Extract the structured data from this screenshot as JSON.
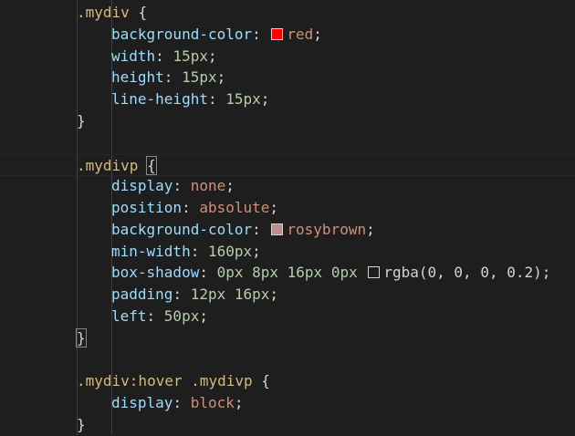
{
  "rules": [
    {
      "selector": ".mydiv",
      "open": "{",
      "close": "}",
      "declarations": [
        {
          "prop": "background-color",
          "value": "red",
          "swatch": "#ff0000"
        },
        {
          "prop": "width",
          "value": "15px"
        },
        {
          "prop": "height",
          "value": "15px"
        },
        {
          "prop": "line-height",
          "value": "15px"
        }
      ]
    },
    {
      "selector": ".mydivp",
      "open": "{",
      "close": "}",
      "declarations": [
        {
          "prop": "display",
          "value": "none"
        },
        {
          "prop": "position",
          "value": "absolute"
        },
        {
          "prop": "background-color",
          "value": "rosybrown",
          "swatch": "#bc8f8f"
        },
        {
          "prop": "min-width",
          "value": "160px"
        },
        {
          "prop": "box-shadow",
          "value": "0px 8px 16px 0px",
          "value2": "rgba(0, 0, 0, 0.2)",
          "swatch": "#000000"
        },
        {
          "prop": "padding",
          "value": "12px 16px"
        },
        {
          "prop": "left",
          "value": "50px"
        }
      ]
    },
    {
      "selector": ".mydiv:hover .mydivp",
      "open": "{",
      "close": "}",
      "declarations": [
        {
          "prop": "display",
          "value": "block"
        }
      ]
    }
  ],
  "colors": {
    "background": "#1e1e1e",
    "selector": "#d7ba7d",
    "property": "#9cdcfe",
    "number": "#b5cea8",
    "keyword": "#ce9178"
  }
}
